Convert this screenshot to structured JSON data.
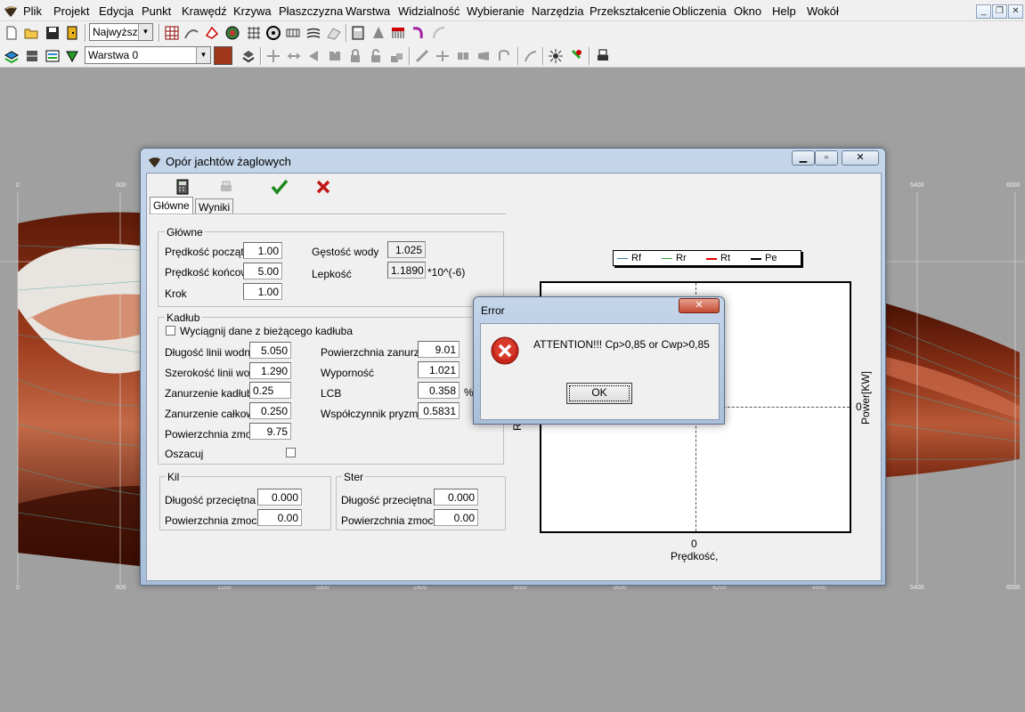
{
  "menubar": {
    "items": [
      "Plik",
      "Projekt",
      "Edycja",
      "Punkt",
      "Krawędź",
      "Krzywa",
      "Płaszczyzna",
      "Warstwa",
      "Widzialność",
      "Wybieranie",
      "Narzędzia",
      "Przekształcenie",
      "Obliczenia",
      "Okno",
      "Help",
      "Wokół"
    ]
  },
  "toolbar": {
    "detail_combo": "Najwyższy",
    "layer_combo": "Warstwa 0",
    "layer_color": "#a0361c"
  },
  "workspace": {
    "ruler_top": [
      "0",
      "600",
      "5400",
      "6000"
    ],
    "ruler_bottom": [
      "0",
      "600",
      "1200",
      "1800",
      "2400",
      "3000",
      "3600",
      "4200",
      "4800",
      "5400",
      "6000"
    ],
    "hull_color": "#7a2a12"
  },
  "dialog": {
    "title": "Opór jachtów żaglowych",
    "tabs": [
      "Główne",
      "Wyniki"
    ],
    "glowne": {
      "title": "Główne",
      "start_speed_label": "Prędkość początkowa",
      "start_speed": "1.00",
      "end_speed_label": "Prędkość końcowa",
      "end_speed": "5.00",
      "step_label": "Krok",
      "step": "1.00",
      "density_label": "Gęstość wody",
      "density": "1.025",
      "viscosity_label": "Lepkość",
      "viscosity": "1.1890",
      "viscosity_unit": "*10^(-6)"
    },
    "kadlub": {
      "title": "Kadłub",
      "extract_label": "Wyciągnij dane z bieżącego kadłuba",
      "lwl_label": "Długość linii wodnej",
      "lwl": "5.050",
      "bwl_label": "Szerokość linii wodnej",
      "bwl": "1.290",
      "draft_hull_label": "Zanurzenie kadłuba",
      "draft_hull": "0.25",
      "draft_total_label": "Zanurzenie całkowite",
      "draft_total": "0.250",
      "wetted_label": "Powierzchnia zmoczona",
      "wetted": "9.75",
      "estimate_label": "Oszacuj",
      "immersed_label": "Powierzchnia zanurzona",
      "immersed": "9.01",
      "displacement_label": "Wyporność",
      "displacement": "1.021",
      "lcb_label": "LCB",
      "lcb": "0.358",
      "lcb_unit": "%",
      "prismatic_label": "Współczynnik pryzmatyczny",
      "prismatic": "0.5831"
    },
    "kil": {
      "title": "Kil",
      "len_label": "Długość przeciętna",
      "len": "0.000",
      "area_label": "Powierzchnia zmoczona",
      "area": "0.00"
    },
    "ster": {
      "title": "Ster",
      "len_label": "Długość przeciętna",
      "len": "0.000",
      "area_label": "Powierzchnia zmoczona",
      "area": "0.00"
    },
    "chart": {
      "legend": [
        {
          "name": "Rf",
          "color": "#3e7ea0"
        },
        {
          "name": "Rr",
          "color": "#2e9a3e"
        },
        {
          "name": "Rt",
          "color": "#e00000"
        },
        {
          "name": "Pe",
          "color": "#000000"
        }
      ],
      "x_tick": "0",
      "xlabel": "Prędkość,",
      "right_tick": "0",
      "ylabel_right": "Power[KW]",
      "ylabel_left": "Re"
    }
  },
  "error_dialog": {
    "title": "Error",
    "message": "ATTENTION!!! Cp>0,85 or Cwp>0,85",
    "ok_label": "OK"
  }
}
